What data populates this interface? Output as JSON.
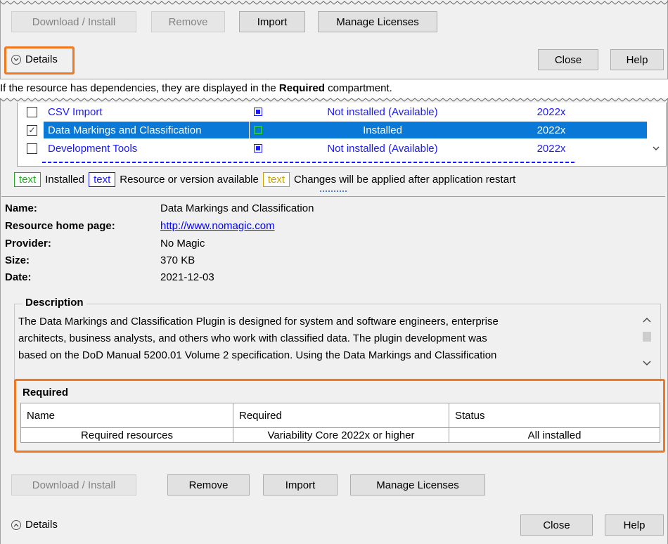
{
  "top_dialog": {
    "buttons": {
      "download_install": "Download / Install",
      "remove": "Remove",
      "import": "Import",
      "manage_licenses": "Manage Licenses",
      "close": "Close",
      "help": "Help"
    },
    "details_label": "Details",
    "details_icon": "chevron-down-circle-icon"
  },
  "caption": {
    "prefix": "If the resource has dependencies, they are displayed in the ",
    "bold": "Required",
    "suffix": " compartment."
  },
  "resources": [
    {
      "name": "CSV Import",
      "status": "Not installed (Available)",
      "version": "2022x",
      "checked": false,
      "selected": false
    },
    {
      "name": "Data Markings and Classification",
      "status": "Installed",
      "version": "2022x",
      "checked": true,
      "selected": true
    },
    {
      "name": "Development Tools",
      "status": "Not installed (Available)",
      "version": "2022x",
      "checked": false,
      "selected": false
    }
  ],
  "legend": {
    "sample": "text",
    "installed": "Installed",
    "available": "Resource or version available",
    "restart": "Changes will be applied after application restart"
  },
  "info": {
    "name_label": "Name:",
    "name_value": "Data Markings and Classification",
    "home_label": "Resource home page:",
    "home_value": "http://www.nomagic.com",
    "provider_label": "Provider:",
    "provider_value": "No Magic",
    "size_label": "Size:",
    "size_value": "370 KB",
    "date_label": "Date:",
    "date_value": "2021-12-03"
  },
  "description": {
    "title": "Description",
    "line1": "The Data Markings and Classification Plugin is designed for system and software engineers, enterprise",
    "line2": "architects, business analysts, and others who work with classified data. The plugin development was",
    "line3": "based on the DoD Manual 5200.01 Volume 2 specification. Using the Data Markings and Classification"
  },
  "required": {
    "title": "Required",
    "headers": [
      "Name",
      "Required",
      "Status"
    ],
    "row": [
      "Required resources",
      "Variability Core 2022x or higher",
      "All installed"
    ]
  },
  "bottom_dialog": {
    "buttons": {
      "download_install": "Download / Install",
      "remove": "Remove",
      "import": "Import",
      "manage_licenses": "Manage Licenses",
      "close": "Close",
      "help": "Help"
    },
    "details_label": "Details",
    "details_icon": "chevron-up-circle-icon"
  },
  "colors": {
    "highlight": "#f07820",
    "selection": "#0a78d7",
    "link": "#0000ff",
    "installed_green": "#22aa22",
    "available_blue": "#1a1aff",
    "restart_yellow": "#c9a200"
  }
}
